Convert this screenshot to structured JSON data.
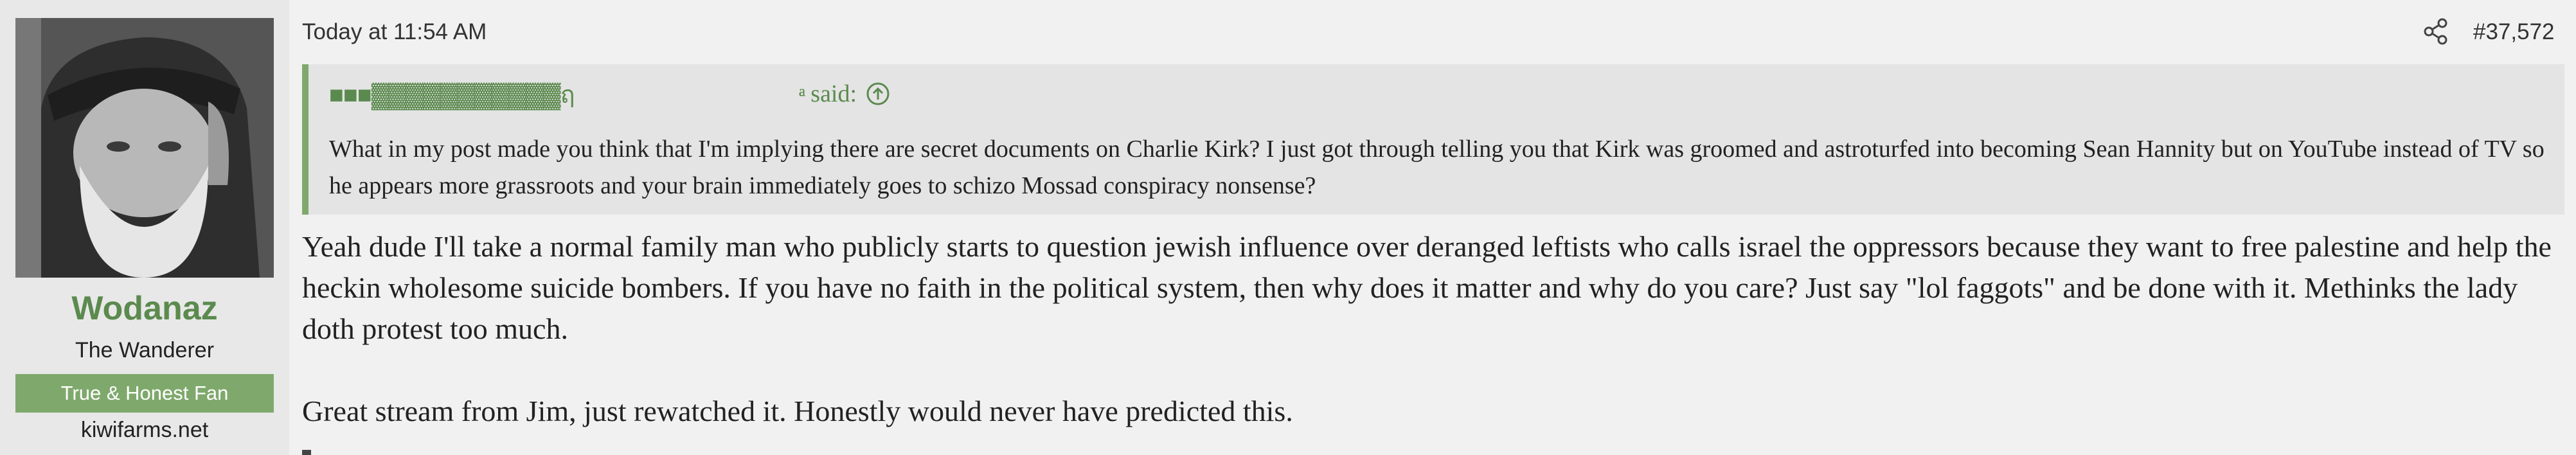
{
  "user": {
    "username": "Wodanaz",
    "title": "The Wanderer",
    "banner": "True & Honest Fan",
    "site": "kiwifarms.net"
  },
  "post": {
    "timestamp": "Today at 11:54 AM",
    "number": "#37,572"
  },
  "quote": {
    "author": "■■■▓▓▓▓▓▓▓▓▓▓▓ฤค๊๊๊๊๊๊๊๊๊๊๊ͣͣͣͣͣͣͣ",
    "said_label": "said:",
    "text": "What in my post made you think that I'm implying there are secret documents on Charlie Kirk? I just got through telling you that Kirk was groomed and astroturfed into becoming Sean Hannity but on YouTube instead of TV so he appears more grassroots and your brain immediately goes to schizo Mossad conspiracy nonsense?"
  },
  "message": {
    "paragraph1": "Yeah dude I'll take a normal family man who publicly starts to question jewish influence over deranged leftists who calls israel the oppressors because they want to free palestine and help the heckin wholesome suicide bombers. If you have no faith in the political system, then why does it matter and why do you care? Just say \"lol faggots\" and be done with it. Methinks the lady doth protest too much.",
    "paragraph2": "Great stream from Jim, just rewatched it. Honestly would never have predicted this."
  },
  "colors": {
    "accent": "#7fa96c",
    "username": "#5b8a4e",
    "quote_bg": "#e4e4e4",
    "page_bg": "#f1f1f1"
  },
  "icons": [
    "share-icon",
    "arrow-up-icon"
  ]
}
